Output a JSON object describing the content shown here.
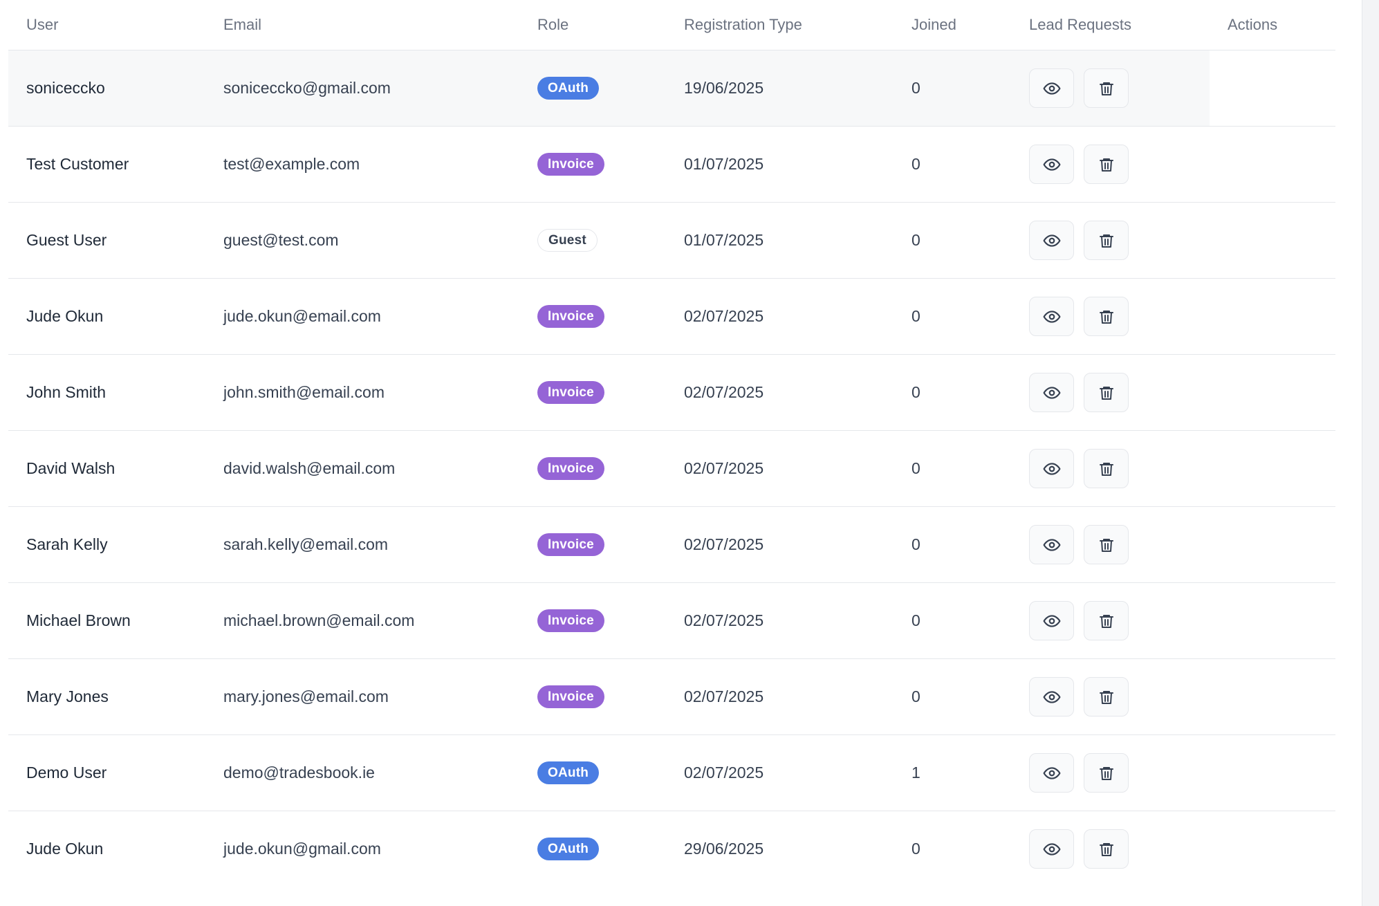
{
  "table": {
    "headers": {
      "user": "User",
      "email": "Email",
      "role": "Role",
      "registration_type": "Registration Type",
      "joined": "Joined",
      "lead_requests": "Lead Requests",
      "actions": "Actions"
    },
    "rows": [
      {
        "name": "soniceccko",
        "email": "soniceccko@gmail.com",
        "role": "OAuth",
        "role_kind": "oauth",
        "date": "19/06/2025",
        "count": "0"
      },
      {
        "name": "Test Customer",
        "email": "test@example.com",
        "role": "Invoice",
        "role_kind": "invoice",
        "date": "01/07/2025",
        "count": "0"
      },
      {
        "name": "Guest User",
        "email": "guest@test.com",
        "role": "Guest",
        "role_kind": "guest",
        "date": "01/07/2025",
        "count": "0"
      },
      {
        "name": "Jude Okun",
        "email": "jude.okun@email.com",
        "role": "Invoice",
        "role_kind": "invoice",
        "date": "02/07/2025",
        "count": "0"
      },
      {
        "name": "John Smith",
        "email": "john.smith@email.com",
        "role": "Invoice",
        "role_kind": "invoice",
        "date": "02/07/2025",
        "count": "0"
      },
      {
        "name": "David Walsh",
        "email": "david.walsh@email.com",
        "role": "Invoice",
        "role_kind": "invoice",
        "date": "02/07/2025",
        "count": "0"
      },
      {
        "name": "Sarah Kelly",
        "email": "sarah.kelly@email.com",
        "role": "Invoice",
        "role_kind": "invoice",
        "date": "02/07/2025",
        "count": "0"
      },
      {
        "name": "Michael Brown",
        "email": "michael.brown@email.com",
        "role": "Invoice",
        "role_kind": "invoice",
        "date": "02/07/2025",
        "count": "0"
      },
      {
        "name": "Mary Jones",
        "email": "mary.jones@email.com",
        "role": "Invoice",
        "role_kind": "invoice",
        "date": "02/07/2025",
        "count": "0"
      },
      {
        "name": "Demo User",
        "email": "demo@tradesbook.ie",
        "role": "OAuth",
        "role_kind": "oauth",
        "date": "02/07/2025",
        "count": "1"
      },
      {
        "name": "Jude Okun",
        "email": "jude.okun@gmail.com",
        "role": "OAuth",
        "role_kind": "oauth",
        "date": "29/06/2025",
        "count": "0"
      }
    ]
  },
  "icons": {
    "view": "eye-icon",
    "delete": "trash-icon"
  },
  "colors": {
    "oauth_badge": "#4a7de3",
    "invoice_badge": "#9564d6",
    "guest_badge_border": "#e5e7eb",
    "row_highlight": "#f7f8f9"
  }
}
